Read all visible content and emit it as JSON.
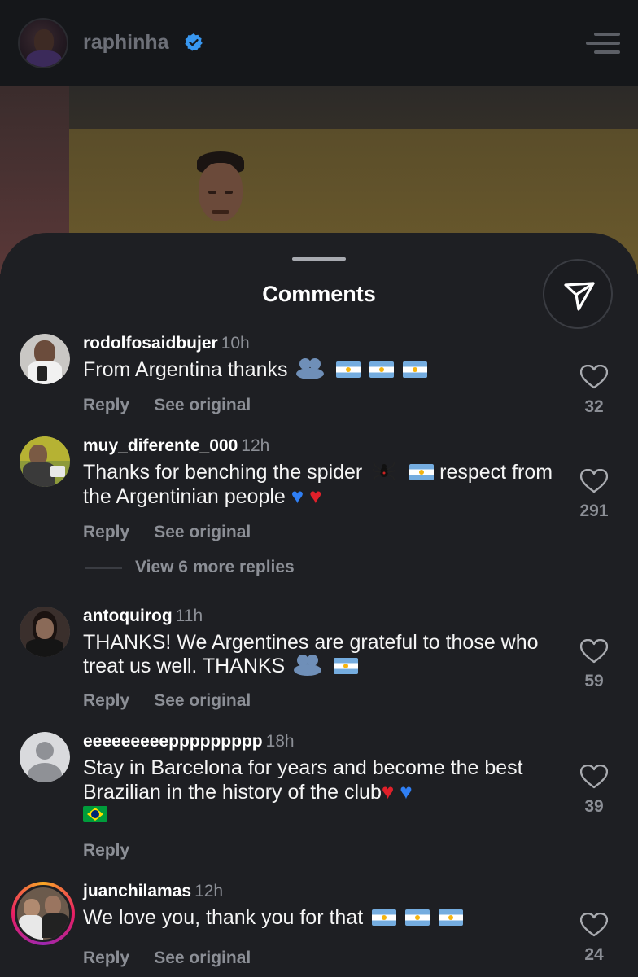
{
  "header": {
    "username": "raphinha",
    "verified_icon": "verified-badge-icon",
    "menu_icon": "hamburger-menu-icon"
  },
  "sheet": {
    "title": "Comments",
    "share_icon": "send-icon"
  },
  "comments": [
    {
      "username": "rodolfosaidbujer",
      "time": "10h",
      "text": "From Argentina thanks",
      "emojis_after": [
        "hug",
        "flag-ar",
        "flag-ar",
        "flag-ar"
      ],
      "actions": [
        "Reply",
        "See original"
      ],
      "likes": "32"
    },
    {
      "username": "muy_diferente_000",
      "time": "12h",
      "text_a": "Thanks for benching the spider",
      "text_b": "respect from the Argentinian people",
      "emojis": [
        "spider",
        "flag-ar",
        "blue-heart",
        "red-heart"
      ],
      "actions": [
        "Reply",
        "See original"
      ],
      "likes": "291"
    },
    {
      "username": "antoquirog",
      "time": "11h",
      "text": "THANKS! We Argentines are grateful to those who treat us well. THANKS",
      "emojis_after": [
        "hug",
        "flag-ar"
      ],
      "actions": [
        "Reply",
        "See original"
      ],
      "likes": "59"
    },
    {
      "username": "eeeeeeeeeppppppppp",
      "time": "18h",
      "text": "Stay in Barcelona for years and become the best Brazilian in the history of the club",
      "emojis_after": [
        "red-heart",
        "blue-heart",
        "flag-br"
      ],
      "actions": [
        "Reply"
      ],
      "likes": "39"
    },
    {
      "username": "juanchilamas",
      "time": "12h",
      "text": "We love you, thank you for that",
      "emojis_after": [
        "flag-ar",
        "flag-ar",
        "flag-ar"
      ],
      "actions": [
        "Reply",
        "See original"
      ],
      "likes": "24"
    }
  ],
  "replies": {
    "view_more": "View 6 more replies"
  },
  "icons": {
    "like": "heart-outline-icon"
  }
}
